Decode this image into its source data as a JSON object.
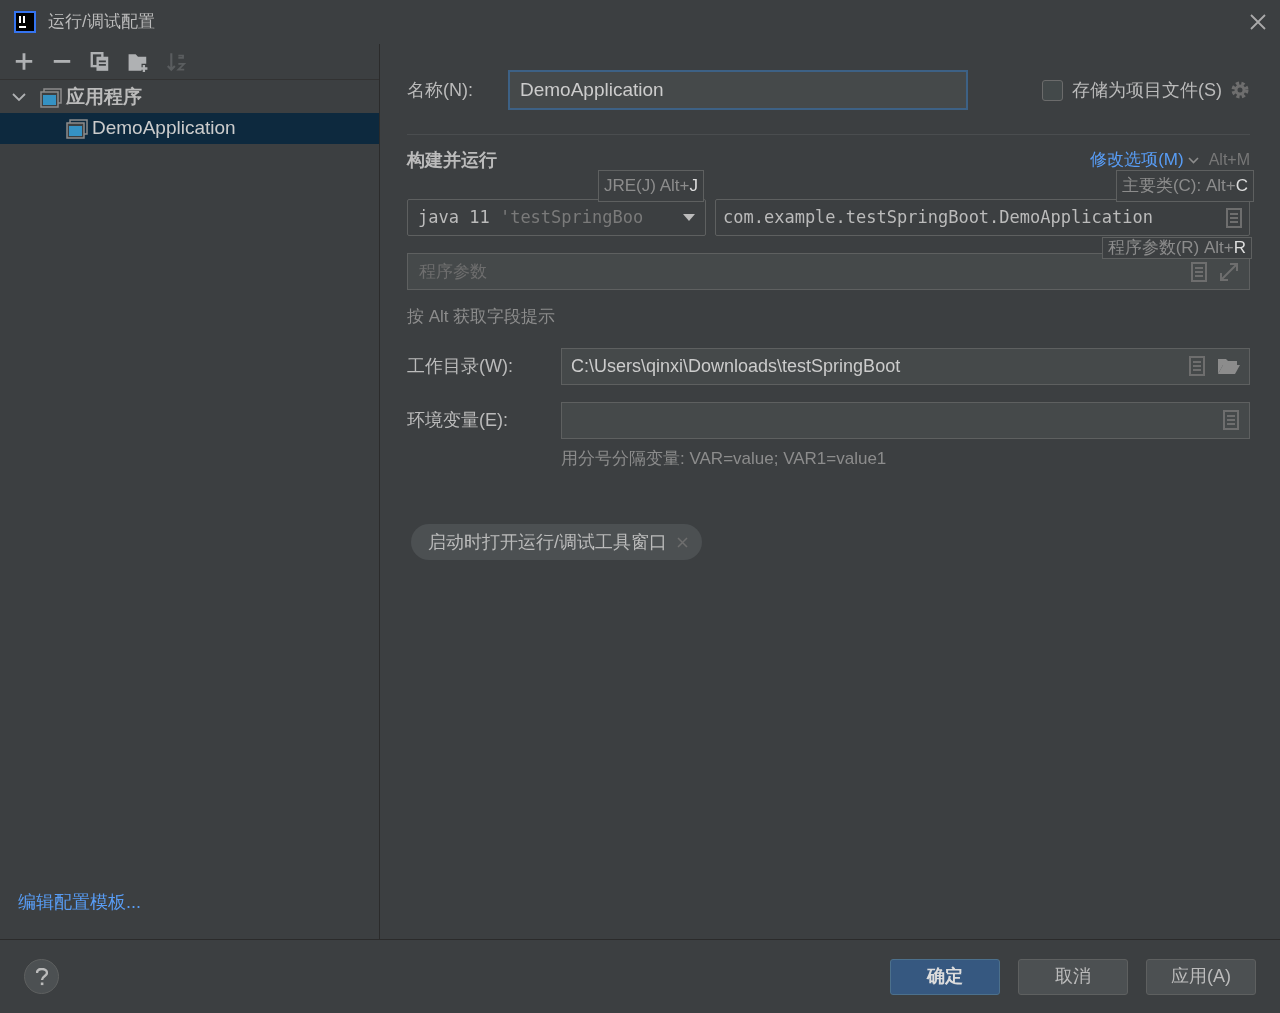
{
  "window": {
    "title": "运行/调试配置"
  },
  "toolbar": [
    {
      "kind": "add",
      "disabled": false
    },
    {
      "kind": "remove",
      "disabled": false
    },
    {
      "kind": "copy",
      "disabled": false
    },
    {
      "kind": "folder",
      "disabled": false
    },
    {
      "kind": "sort",
      "disabled": true
    }
  ],
  "tree": [
    {
      "label": "应用程序",
      "expanded": true,
      "selected": false,
      "children": [
        {
          "label": "DemoApplication",
          "selected": true
        }
      ]
    }
  ],
  "edit_templates_link": "编辑配置模板...",
  "name_field": {
    "label": "名称(N):",
    "value": "DemoApplication"
  },
  "store_as_project_file": {
    "label": "存储为项目文件(S)",
    "checked": false
  },
  "section": {
    "title": "构建并运行",
    "modify_options": "修改选项(M)",
    "modify_shortcut": "Alt+M"
  },
  "jre": {
    "value": "java 11",
    "hint": "'testSpringBoo"
  },
  "main_class": {
    "value": "com.example.testSpringBoot.DemoApplication"
  },
  "program_args": {
    "placeholder": "程序参数"
  },
  "alt_hint": "按 Alt 获取字段提示",
  "working_dir": {
    "label": "工作目录(W):",
    "value": "C:\\Users\\qinxi\\Downloads\\testSpringBoot"
  },
  "env": {
    "label": "环境变量(E):",
    "hint": "用分号分隔变量: VAR=value; VAR1=value1"
  },
  "tags": [
    {
      "label": "启动时打开运行/调试工具窗口"
    }
  ],
  "tooltips": [
    {
      "label": "JRE(J) Alt+",
      "key": "J"
    },
    {
      "label": "主要类(C): Alt+",
      "key": "C"
    },
    {
      "label": "程序参数(R) Alt+",
      "key": "R"
    }
  ],
  "buttons": [
    {
      "label": "确定",
      "default": true
    },
    {
      "label": "取消",
      "default": false
    },
    {
      "label": "应用(A)",
      "default": false
    }
  ]
}
